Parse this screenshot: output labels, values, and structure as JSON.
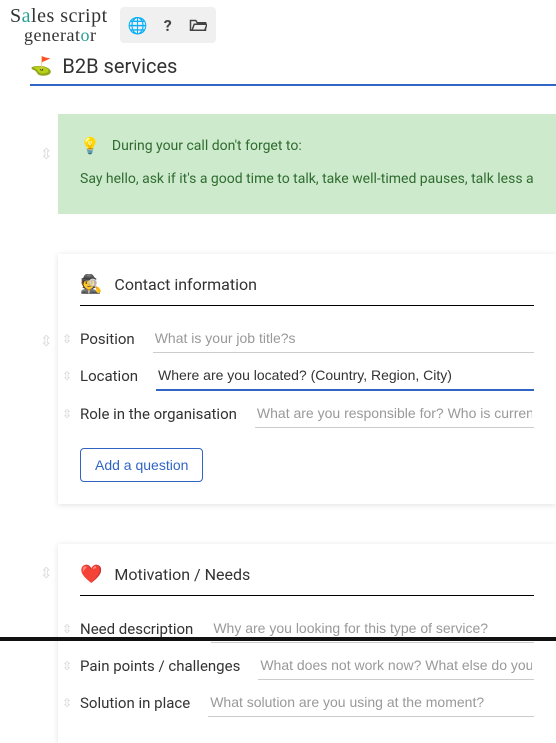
{
  "logo": {
    "line1_pre": "S",
    "line1_accent": "a",
    "line1_post": "les script",
    "line2_pre": "generat",
    "line2_accent": "o",
    "line2_post": "r"
  },
  "pageTitle": "B2B services",
  "tip": {
    "title": "During your call don't forget to:",
    "body": "Say hello, ask if it's a good time to talk, take well-timed pauses, talk less an"
  },
  "contact": {
    "title": "Contact information",
    "fields": [
      {
        "label": "Position",
        "placeholder": "What is your job title?s",
        "value": ""
      },
      {
        "label": "Location",
        "placeholder": "",
        "value": "Where are you located? (Country, Region, City)"
      },
      {
        "label": "Role in the organisation",
        "placeholder": "What are you responsible for? Who is currently resp",
        "value": ""
      }
    ],
    "addLabel": "Add a question"
  },
  "motivation": {
    "title": "Motivation / Needs",
    "fields": [
      {
        "label": "Need description",
        "placeholder": "Why are you looking for this type of service?",
        "value": ""
      },
      {
        "label": "Pain points / challenges",
        "placeholder": "What does not work now? What else do you need?",
        "value": ""
      },
      {
        "label": "Solution in place",
        "placeholder": "What solution are you using at the moment?",
        "value": ""
      }
    ]
  }
}
